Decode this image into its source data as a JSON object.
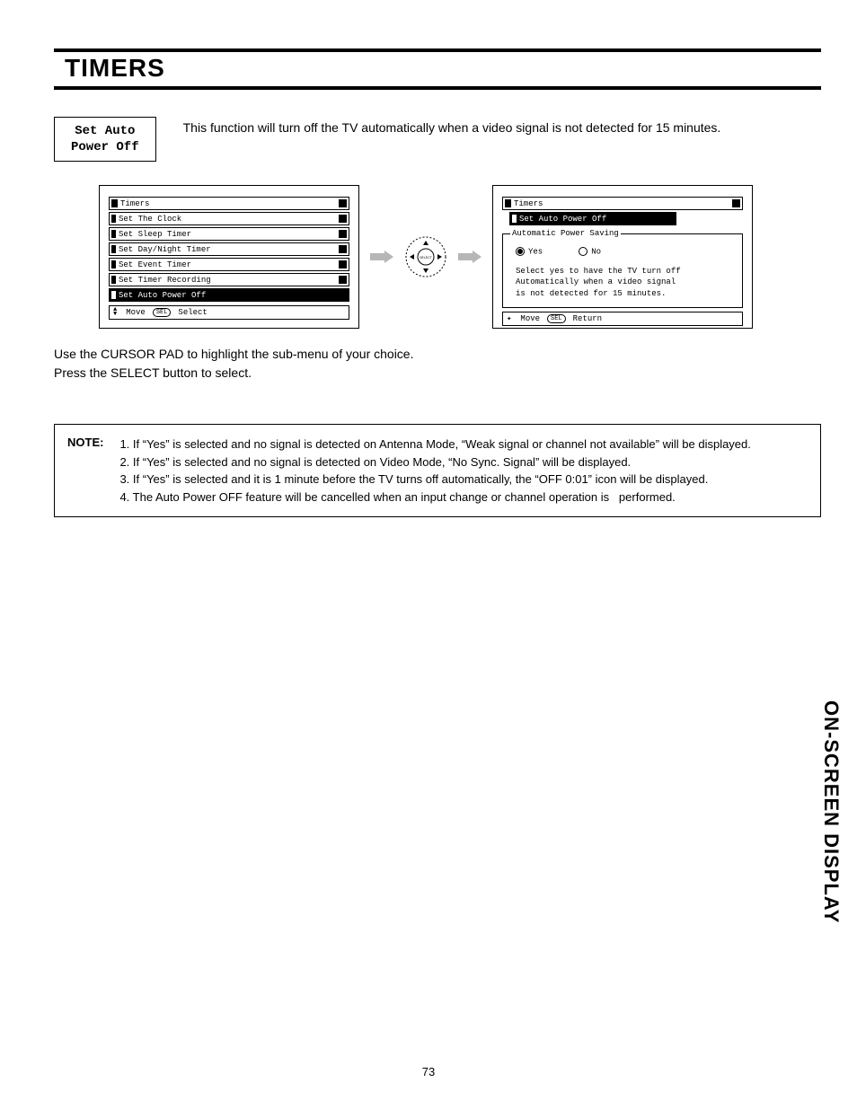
{
  "title": "TIMERS",
  "feature": {
    "name_l1": "Set Auto",
    "name_l2": "Power Off"
  },
  "feature_desc": "This function will turn off the TV automatically when a video signal is not detected for 15 minutes.",
  "menu1": {
    "header": "Timers",
    "items": [
      "Set The Clock",
      "Set Sleep Timer",
      "Set Day/Night Timer",
      "Set Event Timer",
      "Set Timer Recording",
      "Set Auto Power Off"
    ],
    "highlight_index": 5,
    "footer_move": "Move",
    "footer_sel_badge": "SEL",
    "footer_select": "Select"
  },
  "remote": {
    "center_label": "SELECT"
  },
  "menu2": {
    "header": "Timers",
    "row_label": "Set Auto Power Off",
    "group_legend": "Automatic Power Saving",
    "opt_yes": "Yes",
    "opt_no": "No",
    "desc_l1": "Select yes to have the TV turn off",
    "desc_l2": "Automatically when a video signal",
    "desc_l3": "is not detected for 15 minutes.",
    "footer_move": "Move",
    "footer_sel_badge": "SEL",
    "footer_return": "Return"
  },
  "instructions_l1": "Use the CURSOR PAD to highlight the sub-menu of your choice.",
  "instructions_l2": "Press the SELECT button to select.",
  "note": {
    "label": "NOTE:",
    "n1": "1. If “Yes” is selected and no signal is detected on Antenna Mode, “Weak signal or channel not available” will be displayed.",
    "n2": "2. If “Yes” is selected and no signal is detected on Video Mode, “No Sync. Signal” will be displayed.",
    "n3": "3. If “Yes” is selected and it is 1 minute before the TV turns off automatically, the “OFF 0:01” icon will be displayed.",
    "n4": "4. The Auto Power OFF feature will be cancelled when an input change or channel operation is   performed."
  },
  "page_number": "73",
  "side_tab": "ON-SCREEN DISPLAY"
}
